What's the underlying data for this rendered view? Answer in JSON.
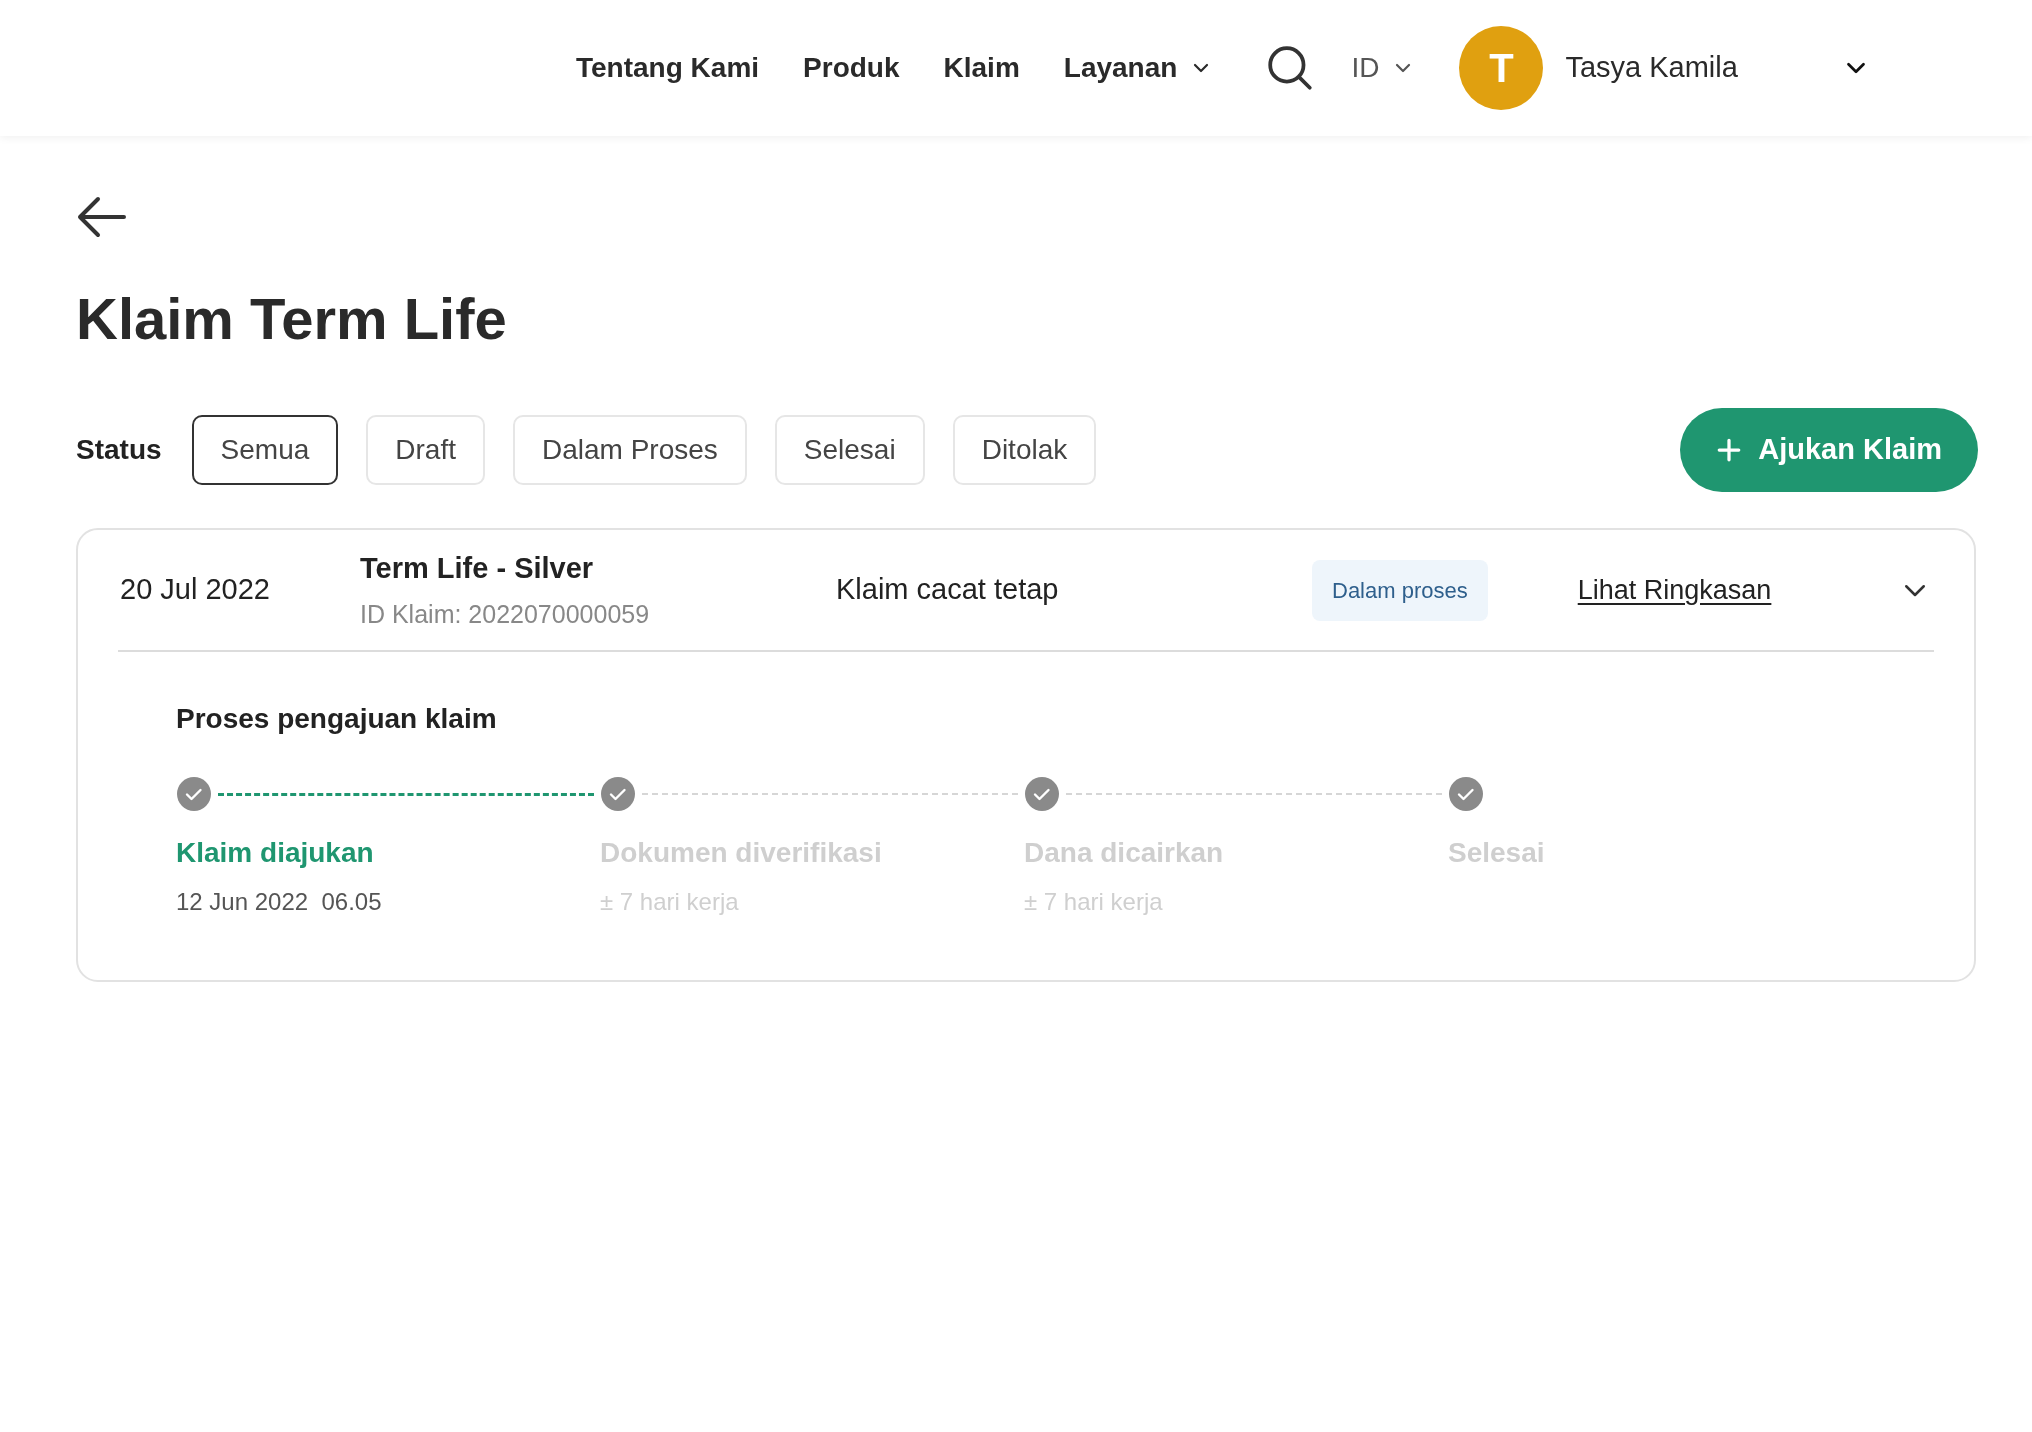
{
  "nav": {
    "links": [
      {
        "label": "Tentang Kami",
        "dropdown": false
      },
      {
        "label": "Produk",
        "dropdown": false
      },
      {
        "label": "Klaim",
        "dropdown": false
      },
      {
        "label": "Layanan",
        "dropdown": true
      }
    ],
    "language": "ID",
    "user": {
      "initial": "T",
      "name": "Tasya Kamila"
    }
  },
  "page": {
    "title": "Klaim Term Life"
  },
  "filters": {
    "label": "Status",
    "options": [
      {
        "label": "Semua",
        "selected": true
      },
      {
        "label": "Draft",
        "selected": false
      },
      {
        "label": "Dalam Proses",
        "selected": false
      },
      {
        "label": "Selesai",
        "selected": false
      },
      {
        "label": "Ditolak",
        "selected": false
      }
    ],
    "action": "Ajukan Klaim"
  },
  "claims": [
    {
      "date": "20 Jul 2022",
      "product": "Term Life - Silver",
      "claim_id": "ID Klaim: 2022070000059",
      "type": "Klaim cacat tetap",
      "status": "Dalam proses",
      "link": "Lihat Ringkasan",
      "expanded": true,
      "process": {
        "title": "Proses pengajuan klaim",
        "steps": [
          {
            "label": "Klaim diajukan",
            "detail": "12 Jun 2022  06.05",
            "done": true
          },
          {
            "label": "Dokumen diverifikasi",
            "detail": "± 7 hari kerja",
            "done": false
          },
          {
            "label": "Dana dicairkan",
            "detail": "± 7 hari kerja",
            "done": false
          },
          {
            "label": "Selesai",
            "done": false
          }
        ]
      }
    }
  ]
}
